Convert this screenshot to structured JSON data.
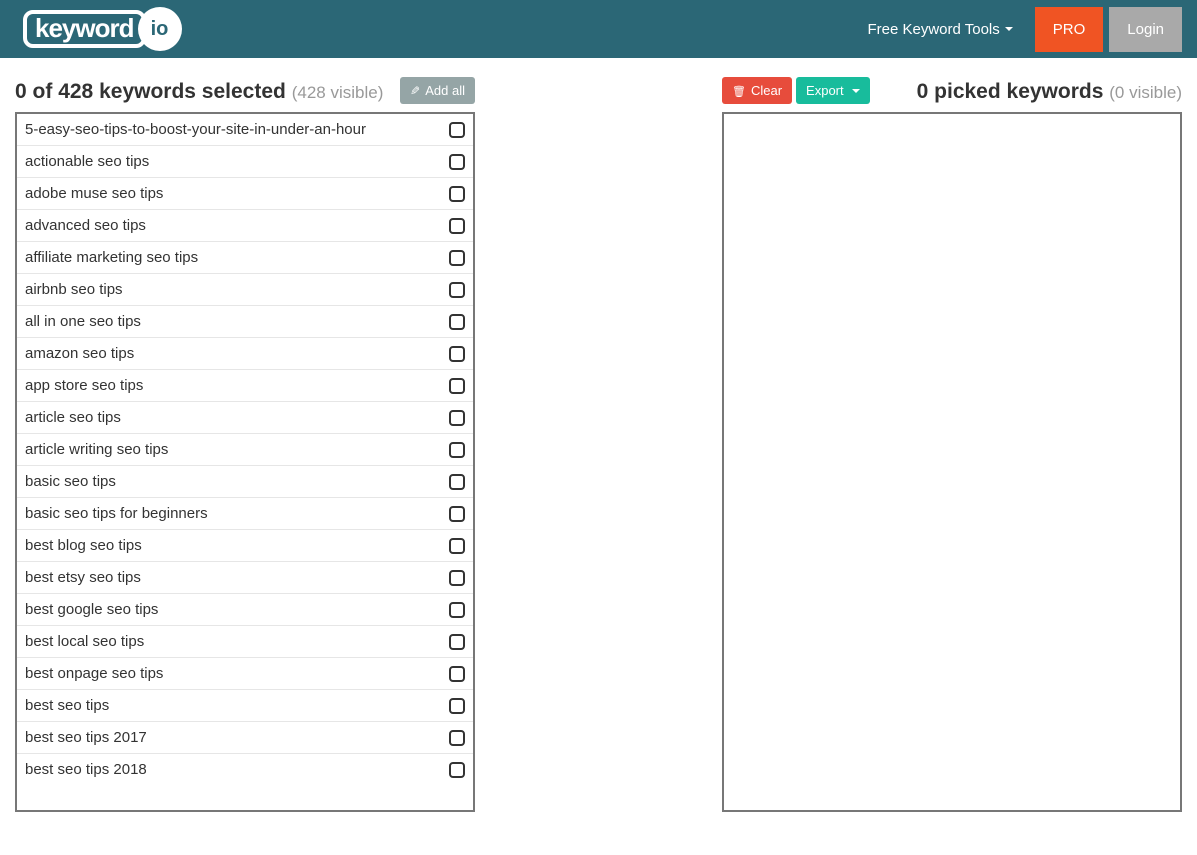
{
  "navbar": {
    "logo_word": "keyword",
    "logo_io": "io",
    "tools_label": "Free Keyword Tools",
    "pro_label": "PRO",
    "login_label": "Login"
  },
  "left": {
    "selected_count": "0",
    "total_count": "428",
    "heading_prefix": "of",
    "heading_suffix": "keywords selected",
    "visible_text": "(428 visible)",
    "add_all_label": "Add all",
    "keywords": [
      "5-easy-seo-tips-to-boost-your-site-in-under-an-hour",
      "actionable seo tips",
      "adobe muse seo tips",
      "advanced seo tips",
      "affiliate marketing seo tips",
      "airbnb seo tips",
      "all in one seo tips",
      "amazon seo tips",
      "app store seo tips",
      "article seo tips",
      "article writing seo tips",
      "basic seo tips",
      "basic seo tips for beginners",
      "best blog seo tips",
      "best etsy seo tips",
      "best google seo tips",
      "best local seo tips",
      "best onpage seo tips",
      "best seo tips",
      "best seo tips 2017",
      "best seo tips 2018"
    ]
  },
  "right": {
    "clear_label": "Clear",
    "export_label": "Export",
    "picked_count": "0",
    "heading_suffix": "picked keywords",
    "visible_text": "(0 visible)"
  }
}
